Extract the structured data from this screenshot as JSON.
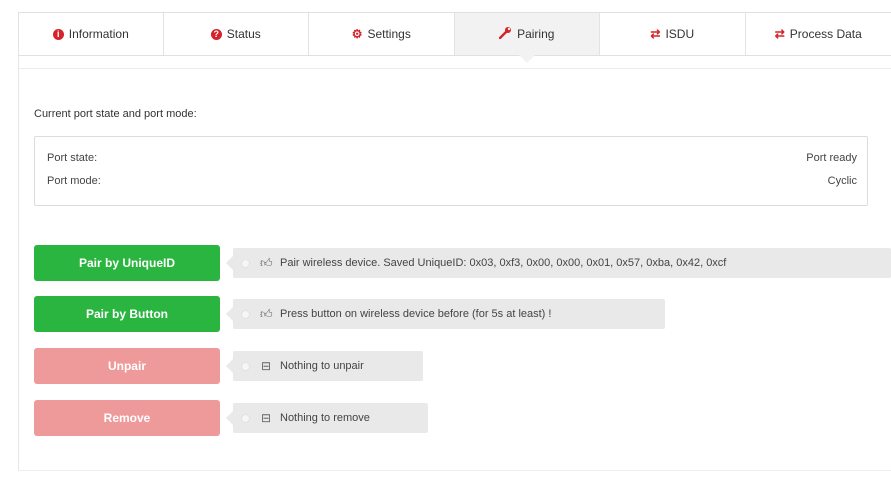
{
  "tabs": [
    {
      "label": "Information",
      "icon": "info-circle-icon",
      "glyph": "i"
    },
    {
      "label": "Status",
      "icon": "question-circle-icon",
      "glyph": "?"
    },
    {
      "label": "Settings",
      "icon": "gear-icon",
      "glyph": "⚙"
    },
    {
      "label": "Pairing",
      "icon": "wrench-icon",
      "glyph": "🔧"
    },
    {
      "label": "ISDU",
      "icon": "exchange-icon",
      "glyph": "⇄"
    },
    {
      "label": "Process Data",
      "icon": "exchange-icon",
      "glyph": "⇄"
    }
  ],
  "active_tab": "Pairing",
  "section_title": "Current port state and port mode:",
  "port": {
    "state_label": "Port state:",
    "state_value": "Port ready",
    "mode_label": "Port mode:",
    "mode_value": "Cyclic"
  },
  "actions": [
    {
      "label": "Pair by UniqueID",
      "style": "green",
      "hint_icon": "thumbs-up-icon",
      "hint": "Pair wireless device. Saved UniqueID: 0x03, 0xf3, 0x00, 0x00, 0x01, 0x57, 0xba, 0x42, 0xcf"
    },
    {
      "label": "Pair by Button",
      "style": "green",
      "hint_icon": "thumbs-up-icon",
      "hint": "Press button on wireless device before (for 5s at least) !"
    },
    {
      "label": "Unpair",
      "style": "pink",
      "hint_icon": "minus-square-icon",
      "hint": "Nothing to unpair"
    },
    {
      "label": "Remove",
      "style": "pink",
      "hint_icon": "minus-square-icon",
      "hint": "Nothing to remove"
    }
  ],
  "colors": {
    "primary_green": "#29b540",
    "disabled_pink": "#ef9a9a",
    "icon_red": "#d5232a"
  }
}
